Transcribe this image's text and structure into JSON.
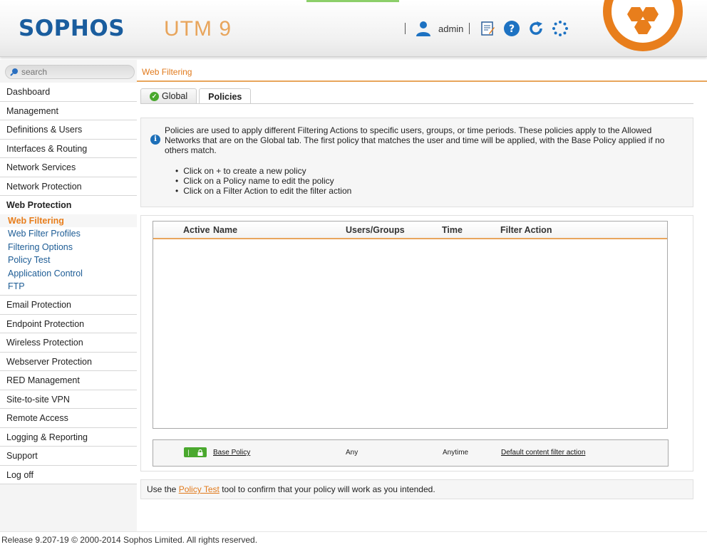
{
  "header": {
    "logo": "SOPHOS",
    "product": "UTM 9",
    "user": "admin",
    "icons": [
      "user-icon",
      "notepad-icon",
      "help-icon",
      "reload-icon",
      "loading-spinner-icon"
    ],
    "brand_color": "#1a5d9e",
    "accent_color": "#e87e1c"
  },
  "sidebar": {
    "search_placeholder": "search",
    "items_top": [
      "Dashboard",
      "Management",
      "Definitions & Users",
      "Interfaces & Routing",
      "Network Services",
      "Network Protection"
    ],
    "group": {
      "title": "Web Protection",
      "subitems": [
        "Web Filtering",
        "Web Filter Profiles",
        "Filtering Options",
        "Policy Test",
        "Application Control",
        "FTP"
      ],
      "active": "Web Filtering"
    },
    "items_bottom": [
      "Email Protection",
      "Endpoint Protection",
      "Wireless Protection",
      "Webserver Protection",
      "RED Management",
      "Site-to-site VPN",
      "Remote Access",
      "Logging & Reporting",
      "Support",
      "Log off"
    ]
  },
  "main": {
    "breadcrumb": "Web Filtering",
    "tabs": [
      {
        "label": "Global",
        "status": "ok"
      },
      {
        "label": "Policies",
        "active": true
      }
    ],
    "info": {
      "text": "Policies are used to apply different Filtering Actions to specific users, groups, or time periods. These policies apply to the Allowed Networks that are on the Global tab. The first policy that matches the user and time will be applied, with the Base Policy applied if no others match.",
      "bullets": [
        "Click on + to create a new policy",
        "Click on a Policy name to edit the policy",
        "Click on a Filter Action to edit the filter action"
      ]
    },
    "table": {
      "columns": [
        "Active",
        "Name",
        "Users/Groups",
        "Time",
        "Filter Action"
      ],
      "rows": []
    },
    "base_policy": {
      "name": "Base Policy",
      "users": "Any",
      "time": "Anytime",
      "filter_action": "Default content filter action"
    },
    "hint": {
      "before": "Use the",
      "link": "Policy Test",
      "after": "tool to confirm that your policy will work as you intended."
    }
  },
  "footer": {
    "text": "Release 9.207-19  © 2000-2014 Sophos Limited. All rights reserved."
  }
}
